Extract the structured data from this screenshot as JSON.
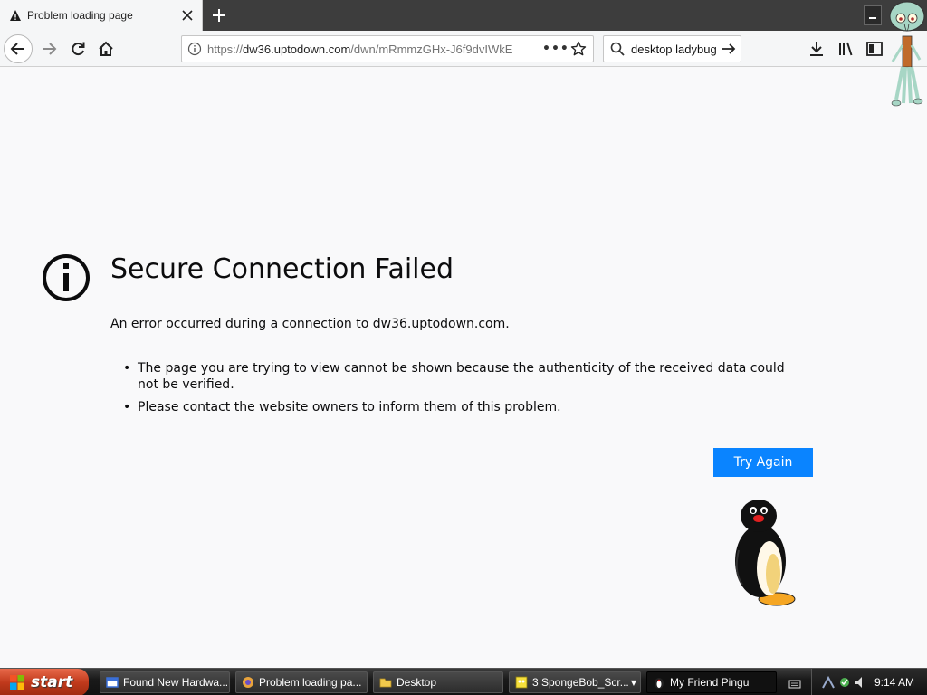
{
  "browser": {
    "tab": {
      "title": "Problem loading page",
      "icon": "warning-icon"
    },
    "url": {
      "prefix": "https://",
      "host": "dw36.uptodown.com",
      "path": "/dwn/mRmmzGHx-J6f9dvIWkE"
    },
    "search": {
      "value": "desktop ladybug"
    }
  },
  "error": {
    "title": "Secure Connection Failed",
    "description": "An error occurred during a connection to dw36.uptodown.com.",
    "bullets": [
      "The page you are trying to view cannot be shown because the authenticity of the received data could not be verified.",
      "Please contact the website owners to inform them of this problem."
    ],
    "button": "Try Again"
  },
  "taskbar": {
    "start": "start",
    "tasks": [
      {
        "label": "Found New Hardwa...",
        "icon": "window-icon"
      },
      {
        "label": "Problem loading pa...",
        "icon": "browser-icon"
      },
      {
        "label": "Desktop",
        "icon": "folder-icon"
      },
      {
        "label": "3 SpongeBob_Scr...",
        "icon": "spongebob-icon"
      },
      {
        "label": "My Friend Pingu",
        "icon": "pingu-icon"
      }
    ],
    "clock": "9:14 AM"
  },
  "colors": {
    "accent": "#0a84ff",
    "page_bg": "#f9f9fa",
    "start_button": "#c13a1c"
  }
}
